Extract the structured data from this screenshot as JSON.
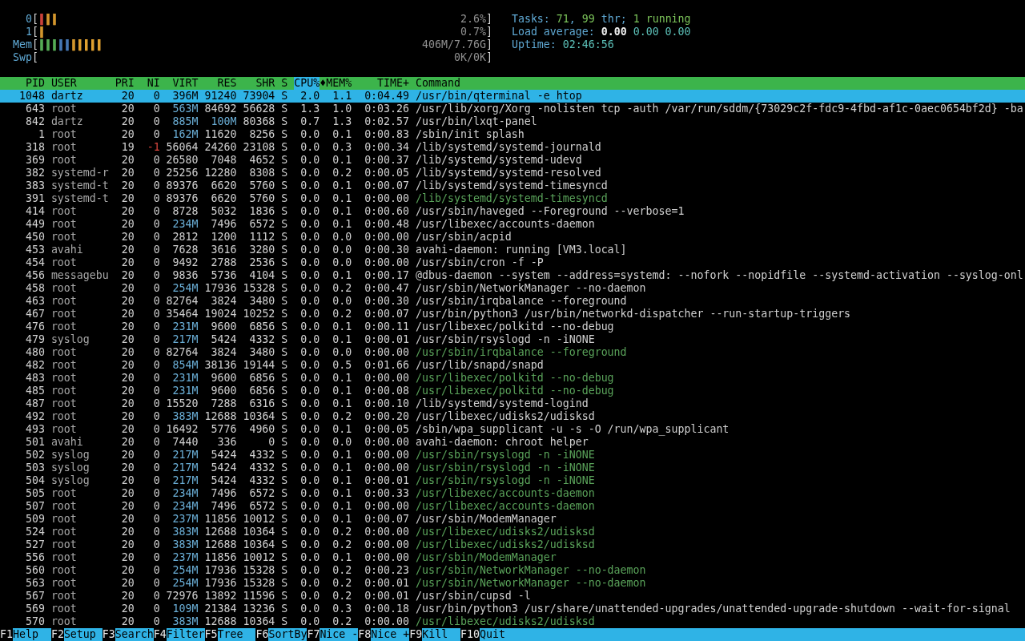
{
  "meters": [
    {
      "label": "0",
      "open": "[",
      "bar": [
        {
          "text": "|",
          "color": "#d9473f"
        },
        {
          "text": "||",
          "color": "#e0a030"
        }
      ],
      "value": "2.6%",
      "close": "]"
    },
    {
      "label": "1",
      "open": "[",
      "bar": [
        {
          "text": "|",
          "color": "#e0a030"
        }
      ],
      "value": "0.7%",
      "close": "]"
    },
    {
      "label": "Mem",
      "open": "[",
      "bar": [
        {
          "text": "|||",
          "color": "#5cb85c"
        },
        {
          "text": "||",
          "color": "#4a7fc0"
        },
        {
          "text": "|||||",
          "color": "#e0a030"
        }
      ],
      "value": "406M/7.76G",
      "close": "]"
    },
    {
      "label": "Swp",
      "open": "[",
      "value": "0K/0K",
      "close": "]"
    }
  ],
  "info": [
    {
      "segments": [
        {
          "text": "Tasks: ",
          "kind": "label"
        },
        {
          "text": "71",
          "kind": "value"
        },
        {
          "text": ", ",
          "kind": "label"
        },
        {
          "text": "99",
          "kind": "value"
        },
        {
          "text": " thr; ",
          "kind": "label"
        },
        {
          "text": "1 running",
          "kind": "value"
        }
      ]
    },
    {
      "segments": [
        {
          "text": "Load average: ",
          "kind": "label"
        },
        {
          "text": "0.00 ",
          "kind": "bright"
        },
        {
          "text": "0.00 ",
          "kind": "info"
        },
        {
          "text": "0.00",
          "kind": "info"
        }
      ]
    },
    {
      "segments": [
        {
          "text": "Uptime: ",
          "kind": "label"
        },
        {
          "text": "02:46:56",
          "kind": "info"
        }
      ]
    }
  ],
  "columns": [
    {
      "label": "PID",
      "selected": false
    },
    {
      "label": "USER",
      "selected": false
    },
    {
      "label": "PRI",
      "selected": false
    },
    {
      "label": "NI",
      "selected": false
    },
    {
      "label": "VIRT",
      "selected": false
    },
    {
      "label": "RES",
      "selected": false
    },
    {
      "label": "SHR",
      "selected": false
    },
    {
      "label": "S",
      "selected": false
    },
    {
      "label": "CPU%",
      "selected": true,
      "sort_indicator": "♦"
    },
    {
      "label": "MEM%",
      "selected": false
    },
    {
      "label": "TIME+",
      "selected": false
    },
    {
      "label": "Command",
      "selected": false
    }
  ],
  "rows": [
    {
      "pid": "1048",
      "user": "dartz",
      "pri": "20",
      "ni": "0",
      "virt": "396M",
      "res": "91240",
      "shr": "73904",
      "s": "S",
      "cpu": "2.0",
      "mem": "1.1",
      "time": "0:04.49",
      "command": "/usr/bin/qterminal -e htop",
      "selected": true,
      "thread": false,
      "niced": false
    },
    {
      "pid": "643",
      "user": "root",
      "pri": "20",
      "ni": "0",
      "virt": "563M",
      "res": "84692",
      "shr": "56628",
      "s": "S",
      "cpu": "1.3",
      "mem": "1.0",
      "time": "0:03.26",
      "command": "/usr/lib/xorg/Xorg -nolisten tcp -auth /var/run/sddm/{73029c2f-fdc9-4fbd-af1c-0aec0654bf2d} -ba",
      "selected": false,
      "thread": false,
      "niced": false
    },
    {
      "pid": "842",
      "user": "dartz",
      "pri": "20",
      "ni": "0",
      "virt": "885M",
      "res": "100M",
      "shr": "80368",
      "s": "S",
      "cpu": "0.7",
      "mem": "1.3",
      "time": "0:02.57",
      "command": "/usr/bin/lxqt-panel",
      "selected": false,
      "thread": false,
      "niced": false
    },
    {
      "pid": "1",
      "user": "root",
      "pri": "20",
      "ni": "0",
      "virt": "162M",
      "res": "11620",
      "shr": "8256",
      "s": "S",
      "cpu": "0.0",
      "mem": "0.1",
      "time": "0:00.83",
      "command": "/sbin/init splash",
      "selected": false,
      "thread": false,
      "niced": false
    },
    {
      "pid": "318",
      "user": "root",
      "pri": "19",
      "ni": "-1",
      "virt": "56064",
      "res": "24260",
      "shr": "23108",
      "s": "S",
      "cpu": "0.0",
      "mem": "0.3",
      "time": "0:00.34",
      "command": "/lib/systemd/systemd-journald",
      "selected": false,
      "thread": false,
      "niced": true
    },
    {
      "pid": "369",
      "user": "root",
      "pri": "20",
      "ni": "0",
      "virt": "26580",
      "res": "7048",
      "shr": "4652",
      "s": "S",
      "cpu": "0.0",
      "mem": "0.1",
      "time": "0:00.37",
      "command": "/lib/systemd/systemd-udevd",
      "selected": false,
      "thread": false,
      "niced": false
    },
    {
      "pid": "382",
      "user": "systemd-r",
      "pri": "20",
      "ni": "0",
      "virt": "25256",
      "res": "12280",
      "shr": "8308",
      "s": "S",
      "cpu": "0.0",
      "mem": "0.2",
      "time": "0:00.05",
      "command": "/lib/systemd/systemd-resolved",
      "selected": false,
      "thread": false,
      "niced": false
    },
    {
      "pid": "383",
      "user": "systemd-t",
      "pri": "20",
      "ni": "0",
      "virt": "89376",
      "res": "6620",
      "shr": "5760",
      "s": "S",
      "cpu": "0.0",
      "mem": "0.1",
      "time": "0:00.07",
      "command": "/lib/systemd/systemd-timesyncd",
      "selected": false,
      "thread": false,
      "niced": false
    },
    {
      "pid": "391",
      "user": "systemd-t",
      "pri": "20",
      "ni": "0",
      "virt": "89376",
      "res": "6620",
      "shr": "5760",
      "s": "S",
      "cpu": "0.0",
      "mem": "0.1",
      "time": "0:00.00",
      "command": "/lib/systemd/systemd-timesyncd",
      "selected": false,
      "thread": true,
      "niced": false
    },
    {
      "pid": "414",
      "user": "root",
      "pri": "20",
      "ni": "0",
      "virt": "8728",
      "res": "5032",
      "shr": "1836",
      "s": "S",
      "cpu": "0.0",
      "mem": "0.1",
      "time": "0:00.60",
      "command": "/usr/sbin/haveged --Foreground --verbose=1",
      "selected": false,
      "thread": false,
      "niced": false
    },
    {
      "pid": "449",
      "user": "root",
      "pri": "20",
      "ni": "0",
      "virt": "234M",
      "res": "7496",
      "shr": "6572",
      "s": "S",
      "cpu": "0.0",
      "mem": "0.1",
      "time": "0:00.48",
      "command": "/usr/libexec/accounts-daemon",
      "selected": false,
      "thread": false,
      "niced": false
    },
    {
      "pid": "450",
      "user": "root",
      "pri": "20",
      "ni": "0",
      "virt": "2812",
      "res": "1200",
      "shr": "1112",
      "s": "S",
      "cpu": "0.0",
      "mem": "0.0",
      "time": "0:00.00",
      "command": "/usr/sbin/acpid",
      "selected": false,
      "thread": false,
      "niced": false
    },
    {
      "pid": "453",
      "user": "avahi",
      "pri": "20",
      "ni": "0",
      "virt": "7628",
      "res": "3616",
      "shr": "3280",
      "s": "S",
      "cpu": "0.0",
      "mem": "0.0",
      "time": "0:00.30",
      "command": "avahi-daemon: running [VM3.local]",
      "selected": false,
      "thread": false,
      "niced": false
    },
    {
      "pid": "454",
      "user": "root",
      "pri": "20",
      "ni": "0",
      "virt": "9492",
      "res": "2788",
      "shr": "2536",
      "s": "S",
      "cpu": "0.0",
      "mem": "0.0",
      "time": "0:00.00",
      "command": "/usr/sbin/cron -f -P",
      "selected": false,
      "thread": false,
      "niced": false
    },
    {
      "pid": "456",
      "user": "messagebu",
      "pri": "20",
      "ni": "0",
      "virt": "9836",
      "res": "5736",
      "shr": "4104",
      "s": "S",
      "cpu": "0.0",
      "mem": "0.1",
      "time": "0:00.17",
      "command": "@dbus-daemon --system --address=systemd: --nofork --nopidfile --systemd-activation --syslog-onl",
      "selected": false,
      "thread": false,
      "niced": false
    },
    {
      "pid": "458",
      "user": "root",
      "pri": "20",
      "ni": "0",
      "virt": "254M",
      "res": "17936",
      "shr": "15328",
      "s": "S",
      "cpu": "0.0",
      "mem": "0.2",
      "time": "0:00.47",
      "command": "/usr/sbin/NetworkManager --no-daemon",
      "selected": false,
      "thread": false,
      "niced": false
    },
    {
      "pid": "463",
      "user": "root",
      "pri": "20",
      "ni": "0",
      "virt": "82764",
      "res": "3824",
      "shr": "3480",
      "s": "S",
      "cpu": "0.0",
      "mem": "0.0",
      "time": "0:00.30",
      "command": "/usr/sbin/irqbalance --foreground",
      "selected": false,
      "thread": false,
      "niced": false
    },
    {
      "pid": "467",
      "user": "root",
      "pri": "20",
      "ni": "0",
      "virt": "35464",
      "res": "19024",
      "shr": "10252",
      "s": "S",
      "cpu": "0.0",
      "mem": "0.2",
      "time": "0:00.07",
      "command": "/usr/bin/python3 /usr/bin/networkd-dispatcher --run-startup-triggers",
      "selected": false,
      "thread": false,
      "niced": false
    },
    {
      "pid": "476",
      "user": "root",
      "pri": "20",
      "ni": "0",
      "virt": "231M",
      "res": "9600",
      "shr": "6856",
      "s": "S",
      "cpu": "0.0",
      "mem": "0.1",
      "time": "0:00.11",
      "command": "/usr/libexec/polkitd --no-debug",
      "selected": false,
      "thread": false,
      "niced": false
    },
    {
      "pid": "479",
      "user": "syslog",
      "pri": "20",
      "ni": "0",
      "virt": "217M",
      "res": "5424",
      "shr": "4332",
      "s": "S",
      "cpu": "0.0",
      "mem": "0.1",
      "time": "0:00.01",
      "command": "/usr/sbin/rsyslogd -n -iNONE",
      "selected": false,
      "thread": false,
      "niced": false
    },
    {
      "pid": "480",
      "user": "root",
      "pri": "20",
      "ni": "0",
      "virt": "82764",
      "res": "3824",
      "shr": "3480",
      "s": "S",
      "cpu": "0.0",
      "mem": "0.0",
      "time": "0:00.00",
      "command": "/usr/sbin/irqbalance --foreground",
      "selected": false,
      "thread": true,
      "niced": false
    },
    {
      "pid": "482",
      "user": "root",
      "pri": "20",
      "ni": "0",
      "virt": "854M",
      "res": "38136",
      "shr": "19144",
      "s": "S",
      "cpu": "0.0",
      "mem": "0.5",
      "time": "0:01.66",
      "command": "/usr/lib/snapd/snapd",
      "selected": false,
      "thread": false,
      "niced": false
    },
    {
      "pid": "483",
      "user": "root",
      "pri": "20",
      "ni": "0",
      "virt": "231M",
      "res": "9600",
      "shr": "6856",
      "s": "S",
      "cpu": "0.0",
      "mem": "0.1",
      "time": "0:00.00",
      "command": "/usr/libexec/polkitd --no-debug",
      "selected": false,
      "thread": true,
      "niced": false
    },
    {
      "pid": "485",
      "user": "root",
      "pri": "20",
      "ni": "0",
      "virt": "231M",
      "res": "9600",
      "shr": "6856",
      "s": "S",
      "cpu": "0.0",
      "mem": "0.1",
      "time": "0:00.08",
      "command": "/usr/libexec/polkitd --no-debug",
      "selected": false,
      "thread": true,
      "niced": false
    },
    {
      "pid": "487",
      "user": "root",
      "pri": "20",
      "ni": "0",
      "virt": "15520",
      "res": "7288",
      "shr": "6316",
      "s": "S",
      "cpu": "0.0",
      "mem": "0.1",
      "time": "0:00.10",
      "command": "/lib/systemd/systemd-logind",
      "selected": false,
      "thread": false,
      "niced": false
    },
    {
      "pid": "492",
      "user": "root",
      "pri": "20",
      "ni": "0",
      "virt": "383M",
      "res": "12688",
      "shr": "10364",
      "s": "S",
      "cpu": "0.0",
      "mem": "0.2",
      "time": "0:00.20",
      "command": "/usr/libexec/udisks2/udisksd",
      "selected": false,
      "thread": false,
      "niced": false
    },
    {
      "pid": "493",
      "user": "root",
      "pri": "20",
      "ni": "0",
      "virt": "16492",
      "res": "5776",
      "shr": "4960",
      "s": "S",
      "cpu": "0.0",
      "mem": "0.1",
      "time": "0:00.05",
      "command": "/sbin/wpa_supplicant -u -s -O /run/wpa_supplicant",
      "selected": false,
      "thread": false,
      "niced": false
    },
    {
      "pid": "501",
      "user": "avahi",
      "pri": "20",
      "ni": "0",
      "virt": "7440",
      "res": "336",
      "shr": "0",
      "s": "S",
      "cpu": "0.0",
      "mem": "0.0",
      "time": "0:00.00",
      "command": "avahi-daemon: chroot helper",
      "selected": false,
      "thread": false,
      "niced": false
    },
    {
      "pid": "502",
      "user": "syslog",
      "pri": "20",
      "ni": "0",
      "virt": "217M",
      "res": "5424",
      "shr": "4332",
      "s": "S",
      "cpu": "0.0",
      "mem": "0.1",
      "time": "0:00.00",
      "command": "/usr/sbin/rsyslogd -n -iNONE",
      "selected": false,
      "thread": true,
      "niced": false
    },
    {
      "pid": "503",
      "user": "syslog",
      "pri": "20",
      "ni": "0",
      "virt": "217M",
      "res": "5424",
      "shr": "4332",
      "s": "S",
      "cpu": "0.0",
      "mem": "0.1",
      "time": "0:00.00",
      "command": "/usr/sbin/rsyslogd -n -iNONE",
      "selected": false,
      "thread": true,
      "niced": false
    },
    {
      "pid": "504",
      "user": "syslog",
      "pri": "20",
      "ni": "0",
      "virt": "217M",
      "res": "5424",
      "shr": "4332",
      "s": "S",
      "cpu": "0.0",
      "mem": "0.1",
      "time": "0:00.01",
      "command": "/usr/sbin/rsyslogd -n -iNONE",
      "selected": false,
      "thread": true,
      "niced": false
    },
    {
      "pid": "505",
      "user": "root",
      "pri": "20",
      "ni": "0",
      "virt": "234M",
      "res": "7496",
      "shr": "6572",
      "s": "S",
      "cpu": "0.0",
      "mem": "0.1",
      "time": "0:00.33",
      "command": "/usr/libexec/accounts-daemon",
      "selected": false,
      "thread": true,
      "niced": false
    },
    {
      "pid": "507",
      "user": "root",
      "pri": "20",
      "ni": "0",
      "virt": "234M",
      "res": "7496",
      "shr": "6572",
      "s": "S",
      "cpu": "0.0",
      "mem": "0.1",
      "time": "0:00.00",
      "command": "/usr/libexec/accounts-daemon",
      "selected": false,
      "thread": true,
      "niced": false
    },
    {
      "pid": "509",
      "user": "root",
      "pri": "20",
      "ni": "0",
      "virt": "237M",
      "res": "11856",
      "shr": "10012",
      "s": "S",
      "cpu": "0.0",
      "mem": "0.1",
      "time": "0:00.07",
      "command": "/usr/sbin/ModemManager",
      "selected": false,
      "thread": false,
      "niced": false
    },
    {
      "pid": "524",
      "user": "root",
      "pri": "20",
      "ni": "0",
      "virt": "383M",
      "res": "12688",
      "shr": "10364",
      "s": "S",
      "cpu": "0.0",
      "mem": "0.2",
      "time": "0:00.00",
      "command": "/usr/libexec/udisks2/udisksd",
      "selected": false,
      "thread": true,
      "niced": false
    },
    {
      "pid": "527",
      "user": "root",
      "pri": "20",
      "ni": "0",
      "virt": "383M",
      "res": "12688",
      "shr": "10364",
      "s": "S",
      "cpu": "0.0",
      "mem": "0.2",
      "time": "0:00.00",
      "command": "/usr/libexec/udisks2/udisksd",
      "selected": false,
      "thread": true,
      "niced": false
    },
    {
      "pid": "556",
      "user": "root",
      "pri": "20",
      "ni": "0",
      "virt": "237M",
      "res": "11856",
      "shr": "10012",
      "s": "S",
      "cpu": "0.0",
      "mem": "0.1",
      "time": "0:00.00",
      "command": "/usr/sbin/ModemManager",
      "selected": false,
      "thread": true,
      "niced": false
    },
    {
      "pid": "560",
      "user": "root",
      "pri": "20",
      "ni": "0",
      "virt": "254M",
      "res": "17936",
      "shr": "15328",
      "s": "S",
      "cpu": "0.0",
      "mem": "0.2",
      "time": "0:00.23",
      "command": "/usr/sbin/NetworkManager --no-daemon",
      "selected": false,
      "thread": true,
      "niced": false
    },
    {
      "pid": "563",
      "user": "root",
      "pri": "20",
      "ni": "0",
      "virt": "254M",
      "res": "17936",
      "shr": "15328",
      "s": "S",
      "cpu": "0.0",
      "mem": "0.2",
      "time": "0:00.01",
      "command": "/usr/sbin/NetworkManager --no-daemon",
      "selected": false,
      "thread": true,
      "niced": false
    },
    {
      "pid": "567",
      "user": "root",
      "pri": "20",
      "ni": "0",
      "virt": "72976",
      "res": "13892",
      "shr": "11596",
      "s": "S",
      "cpu": "0.0",
      "mem": "0.2",
      "time": "0:00.01",
      "command": "/usr/sbin/cupsd -l",
      "selected": false,
      "thread": false,
      "niced": false
    },
    {
      "pid": "569",
      "user": "root",
      "pri": "20",
      "ni": "0",
      "virt": "109M",
      "res": "21384",
      "shr": "13236",
      "s": "S",
      "cpu": "0.0",
      "mem": "0.3",
      "time": "0:00.18",
      "command": "/usr/bin/python3 /usr/share/unattended-upgrades/unattended-upgrade-shutdown --wait-for-signal",
      "selected": false,
      "thread": false,
      "niced": false
    },
    {
      "pid": "570",
      "user": "root",
      "pri": "20",
      "ni": "0",
      "virt": "383M",
      "res": "12688",
      "shr": "10364",
      "s": "S",
      "cpu": "0.0",
      "mem": "0.2",
      "time": "0:00.00",
      "command": "/usr/libexec/udisks2/udisksd",
      "selected": false,
      "thread": true,
      "niced": false
    }
  ],
  "function_keys": [
    {
      "key": "F1",
      "label": "Help"
    },
    {
      "key": "F2",
      "label": "Setup"
    },
    {
      "key": "F3",
      "label": "Search"
    },
    {
      "key": "F4",
      "label": "Filter"
    },
    {
      "key": "F5",
      "label": "Tree"
    },
    {
      "key": "F6",
      "label": "SortBy"
    },
    {
      "key": "F7",
      "label": "Nice -"
    },
    {
      "key": "F8",
      "label": "Nice +"
    },
    {
      "key": "F9",
      "label": "Kill"
    },
    {
      "key": "F10",
      "label": "Quit"
    }
  ]
}
